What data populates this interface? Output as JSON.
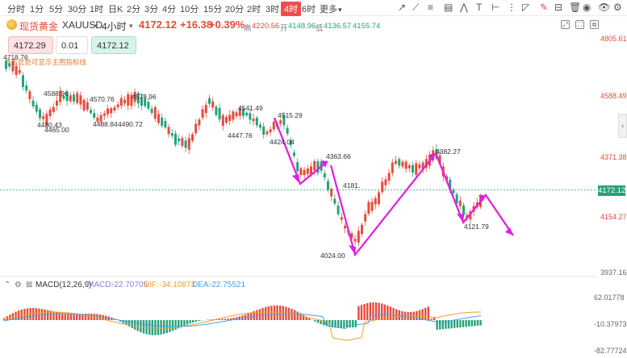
{
  "toolbar": {
    "timeframes": [
      "分时",
      "1分",
      "5分",
      "30分",
      "1时",
      "日K",
      "2分",
      "3分",
      "4分",
      "10分",
      "15分",
      "20分",
      "2时",
      "3时",
      "4时",
      "6时",
      "更多"
    ],
    "active": "4时"
  },
  "symbol": {
    "name": "现货黄金",
    "code": "XAUUSD",
    "period": "4小时",
    "last": "4172.12",
    "change": "+16.38",
    "percent": "+0.39%",
    "high_label": "高",
    "high": "4220.56",
    "open_label": "开",
    "open": "4148.96",
    "low_label": "低",
    "low": "4136.57",
    "close_value": "4155.74"
  },
  "trade": {
    "sell_price": "4172.29",
    "quantity": "0.01",
    "buy_price": "4172.12"
  },
  "overlay_note": "点击此处可显示主图指标线",
  "price_axis": {
    "labels": [
      "4805.61",
      "4588.49",
      "4371.38",
      "4154.27",
      "3937.16"
    ],
    "current": "4172.12"
  },
  "annotations": [
    "4718.76",
    "4588.96",
    "4570.76",
    "4579.96",
    "4480.43",
    "4465.00",
    "4488.84",
    "4490.72",
    "4541.49",
    "4515.29",
    "4447.76",
    "4424.04",
    "4363.66",
    "4382.27",
    "4181.",
    "4121.79",
    "4024.00"
  ],
  "macd": {
    "title": "MACD(12,26,9)",
    "macd_label": "MACD:",
    "macd_value": "-22.70705",
    "dif_label": "DIF:",
    "dif_value": "-34.10873",
    "dea_label": "DEA:",
    "dea_value": "-22.75521",
    "axis": [
      "62.01778",
      "-10.37973",
      "-82.77724"
    ]
  },
  "colors": {
    "up": "#e84b3c",
    "down": "#26a17b",
    "arrow": "#e01ee0",
    "dif": "#f0a030",
    "dea": "#4aa3df"
  }
}
